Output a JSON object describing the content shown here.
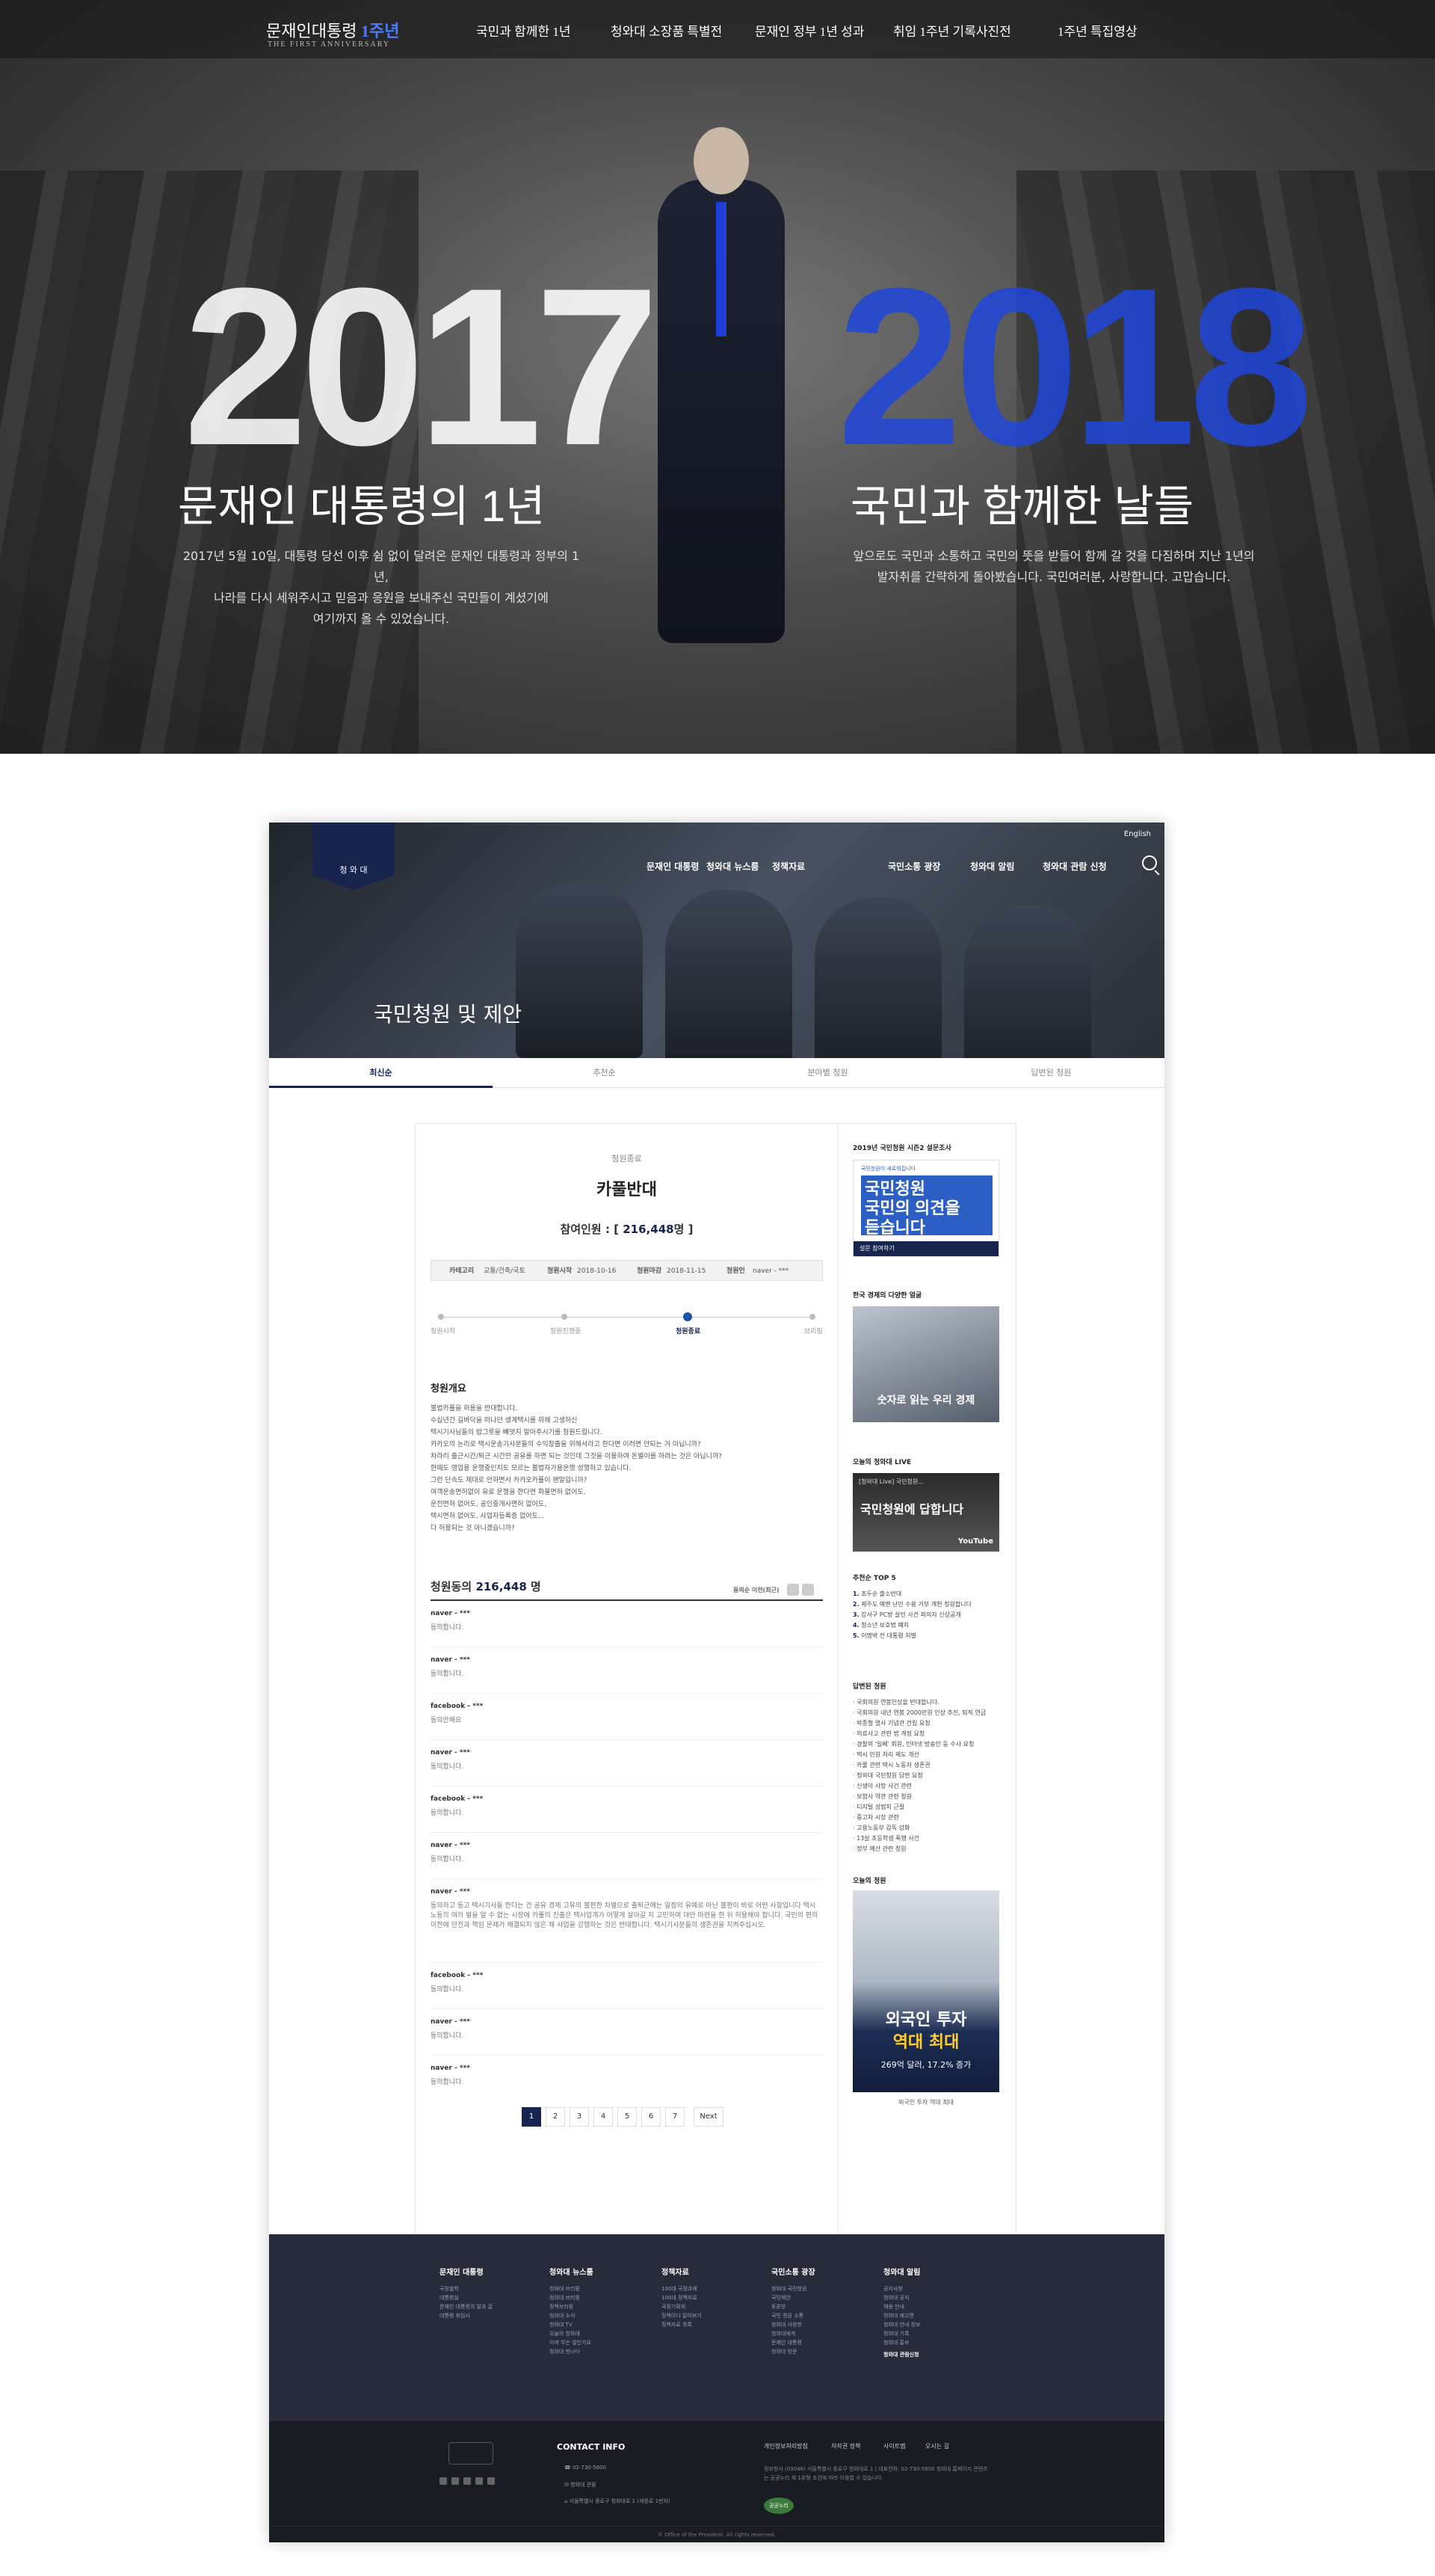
{
  "hero": {
    "logo_main": "문재인대통령",
    "logo_one": "1주년",
    "logo_sub": "THE FIRST ANNIVERSARY",
    "nav": [
      "국민과 함께한 1년",
      "청와대 소장품 특별전",
      "문재인 정부 1년 성과",
      "취임 1주년 기록사진전",
      "1주년 특집영상"
    ],
    "year_left": "2017",
    "year_right": "2018",
    "title_left": "문재인 대통령의 1년",
    "title_right": "국민과 함께한 날들",
    "desc_left_1": "2017년 5월 10일, 대통령 당선 이후 쉼 없이 달려온 문재인 대통령과 정부의 1년,",
    "desc_left_2": "나라를 다시 세워주시고 믿음과 응원을 보내주신 국민들이 계셨기에",
    "desc_left_3": "여기까지 올 수 있었습니다.",
    "desc_right_1": "앞으로도 국민과 소통하고 국민의 뜻을 받들어 함께 갈 것을 다짐하며 지난 1년의",
    "desc_right_2": "발자취를 간략하게 돌아봤습니다. 국민여러분, 사랑합니다. 고맙습니다."
  },
  "site": {
    "shield_text": "청 와 대",
    "english": "English",
    "nav": [
      "문재인 대통령",
      "청와대 뉴스룸",
      "정책자료",
      "국민소통 광장",
      "청와대 알림",
      "청와대 관람 신청"
    ],
    "page_title": "국민청원 및 제안",
    "tabs": [
      "최신순",
      "추천순",
      "분야별 청원",
      "답변된 청원"
    ]
  },
  "petition": {
    "status": "청원종료",
    "title": "카풀반대",
    "count_label": "참여인원 : [",
    "count_value": "216,448",
    "count_suffix": "명 ]",
    "info": {
      "cat_l": "카테고리",
      "cat_v": "교통/건축/국토",
      "start_l": "청원시작",
      "start_v": "2018-10-16",
      "end_l": "청원마감",
      "end_v": "2018-11-15",
      "by_l": "청원인",
      "by_v": "naver - ***"
    },
    "steps": [
      "청원시작",
      "청원진행중",
      "청원종료",
      "브리핑"
    ],
    "overview_h": "청원개요",
    "body": [
      "불법카풀을 허용을 반대합니다.",
      "수십년간 길바닥을 떠나던 생계택시를 위해 고생하신",
      "택시기사님들의 밥그릇을 빼앗지 말아주시기를 청원드립니다.",
      "카카오의 논리로 택시운송기사분들의 수익창출을 위해서라고 한다면 이러면 안되는 거 아닙니까?",
      "차라리 출근시간/퇴근 시간만 공유를 하면 되는 것인데 그것을 이용하여 돈벌이를 하려는 것은 아닙니까?",
      "한때도 영업용 운행중인지도 모르는 불법자가용운행 성행하고 있습니다.",
      "그런 단속도 제대로 안하면서 카카오카풀이 왠말입니까?",
      "여객운송면허없이 유료 운행을 한다면 화물면허 없어도,",
      "운전면허 없어도, 공인중개사면허 없어도,",
      "택시면허 없어도, 사업자등록증 없어도...",
      "다 허용되는 것 아니겠습니까?"
    ],
    "signers_label": "청원동의",
    "signers_count": "216,448",
    "signers_unit": "명",
    "sort": "동의순 이전(최근)",
    "signers": [
      {
        "name": "naver - ***",
        "text": "동의합니다."
      },
      {
        "name": "naver - ***",
        "text": "동의합니다."
      },
      {
        "name": "facebook - ***",
        "text": "동의안해요"
      },
      {
        "name": "naver - ***",
        "text": "동의합니다."
      },
      {
        "name": "facebook - ***",
        "text": "동의합니다."
      },
      {
        "name": "naver - ***",
        "text": "동의합니다."
      },
      {
        "name": "naver - ***",
        "text": "동의하고 동고 택시기사들 한다는 건 공유 경제 고유의 불편한 차별으로 출퇴근에는 일정의 유예로 아닌 불편이 바로 어떤 사항입니다 택시 노동의 여러 발을 알 수 없는 시장에 카풀의 진출은 택시업계가 어떻게 살아갈 지 고민하여 대안 마련을 한 뒤 허용해야 합니다. 국민의 편의 이전에 안전과 책임 문제가 해결되지 않은 채 사업을 강행하는 것은 반대합니다. 택시기사분들의 생존권을 지켜주십시오."
      },
      {
        "name": "facebook - ***",
        "text": "동의합니다."
      },
      {
        "name": "naver - ***",
        "text": "동의합니다."
      },
      {
        "name": "naver - ***",
        "text": "동의합니다."
      }
    ],
    "pages": [
      "1",
      "2",
      "3",
      "4",
      "5",
      "6",
      "7"
    ],
    "next": "Next"
  },
  "aside": {
    "survey_h": "2019년 국민청원 시즌2 설문조사",
    "survey_top": "국민청원이 새로워집니다",
    "survey_big1": "국민청원",
    "survey_big2": "국민의 의견을",
    "survey_big3": "듣습니다",
    "survey_foot": "설문 참여하기",
    "econ_h": "한국 경제의 다양한 얼굴",
    "econ_t": "숫자로 읽는 우리 경제",
    "live_h": "오늘의 청와대 LIVE",
    "live_tp": "[청와대 Live] 국민청원...",
    "live_t": "국민청원에 답합니다",
    "live_yt": "YouTube",
    "top5_h": "추천순 TOP 5",
    "top5": [
      "조두순 출소반대",
      "제주도 예멘 난민 수용 거부 개헌 청원합니다",
      "강서구 PC방 살인 사건 피의자 신상공개",
      "청소년 보호법 폐지",
      "이명박 전 대통령 처벌"
    ],
    "answered_h": "답변된 청원",
    "answered": [
      "국회의원 연봉인상을 반대합니다.",
      "국회의원 내년 연봉 2000만원 인상 추진, 퇴직 연금",
      "박종철 열사 기념관 건립 요청",
      "의료사고 관련 법 개정 요청",
      "경찰의 '일베' 회원, 인터넷 방송인 등 수사 요청",
      "택시 민원 처리 제도 개선",
      "카풀 관련 택시 노동자 생존권",
      "청와대 국민청원 답변 요청",
      "신생아 사망 사건 관련",
      "보험사 약관 관련 청원",
      "디지털 성범죄 근절",
      "중고차 시장 관련",
      "고용노동부 감독 강화",
      "13살 초등학생 폭행 사건",
      "정부 예산 관련 청원"
    ],
    "today_h": "오늘의 청원",
    "today_t1": "외국인 투자",
    "today_t2": "역대 최대",
    "today_t3": "269억 달러, 17.2% 증가",
    "today_cap": "외국인 투자 역대 최대"
  },
  "footer": {
    "cols": [
      {
        "h": "문재인 대통령",
        "items": [
          "국정철학",
          "대통령실",
          "문재인 대통령의 말과 글",
          "대통령 취임사"
        ]
      },
      {
        "h": "청와대 뉴스룸",
        "items": [
          "청와대 브리핑",
          "청와대 브리핑",
          "정책브리핑",
          "청와대 소식",
          "청와대 TV",
          "오늘의 청와대",
          "이게 무슨 일인가요",
          "청와대 만나다"
        ]
      },
      {
        "h": "정책자료",
        "items": [
          "100대 국정과제",
          "100대 정책자료",
          "국정기획위",
          "정책이다 알아보기",
          "정책자료 목록"
        ]
      },
      {
        "h": "국민소통 광장",
        "items": [
          "청와대 국민청원",
          "국민제안",
          "토론방",
          "국민 청원 소통",
          "청와대 사랑방",
          "청와대에게",
          "문재인 대통령",
          "청와대 방문"
        ]
      },
      {
        "h": "청와대 알림",
        "items": [
          "공지사항",
          "청와대 공지",
          "채용 안내",
          "청와대 예고편",
          "청와대 안내 정보",
          "청와대 기록",
          "청와대 홍보"
        ],
        "bold": "청와대 관람신청"
      }
    ],
    "contact_h": "CONTACT INFO",
    "contact": [
      "02-730-5800",
      "청와대 관람",
      "서울특별시 종로구 청와대로 1 (세종로 1번지)"
    ],
    "links": [
      "개인정보처리방침",
      "저작권 정책",
      "사이트맵",
      "오시는 길"
    ],
    "addr": "정부청사 (03048) 서울특별시 종로구 청와대로 1 | 대표전화: 02-730-5800 청와대 홈페이지 콘텐츠는 공공누리 제 1유형 조건에 따라 이용할 수 있습니다.",
    "badge": "공공누리",
    "copyright": "© Office of the President. All rights reserved."
  }
}
